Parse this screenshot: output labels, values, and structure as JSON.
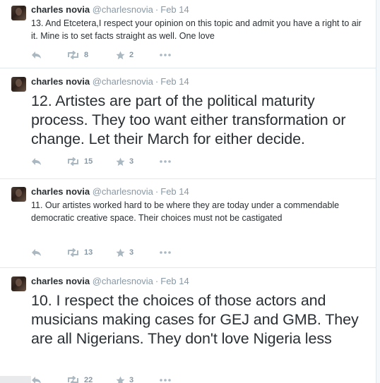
{
  "tweets": [
    {
      "name": "charles novia",
      "handle": "@charlesnovia",
      "date": "Feb 14",
      "text": "13. And Etcetera,I respect your opinion on this topic and admit you have a right to air it.  Mine is to set facts straight as well. One love",
      "size": "small",
      "retweets": "8",
      "favorites": "2"
    },
    {
      "name": "charles novia",
      "handle": "@charlesnovia",
      "date": "Feb 14",
      "text": "12. Artistes are part of the political maturity process. They too want either transformation or change. Let their March for either decide.",
      "size": "large",
      "retweets": "15",
      "favorites": "3"
    },
    {
      "name": "charles novia",
      "handle": "@charlesnovia",
      "date": "Feb 14",
      "text": "11. Our artistes worked hard to be where they are today under a commendable democratic creative space. Their choices must not be castigated",
      "size": "small",
      "retweets": "13",
      "favorites": "3"
    },
    {
      "name": "charles novia",
      "handle": "@charlesnovia",
      "date": "Feb 14",
      "text": "10. I respect the choices of those actors and musicians making cases for GEJ and GMB. They are all Nigerians. They don't love Nigeria less",
      "size": "large",
      "retweets": "22",
      "favorites": "3"
    }
  ],
  "colors": {
    "name": "#292f33",
    "meta": "#8899a6",
    "divider": "#e1e8ed",
    "icon": "#aab8c2"
  },
  "icons": {
    "avatar": "profile-photo",
    "reply": "reply-arrow-icon",
    "retweet": "retweet-arrows-icon",
    "favorite": "star-icon",
    "more": "ellipsis-icon"
  }
}
